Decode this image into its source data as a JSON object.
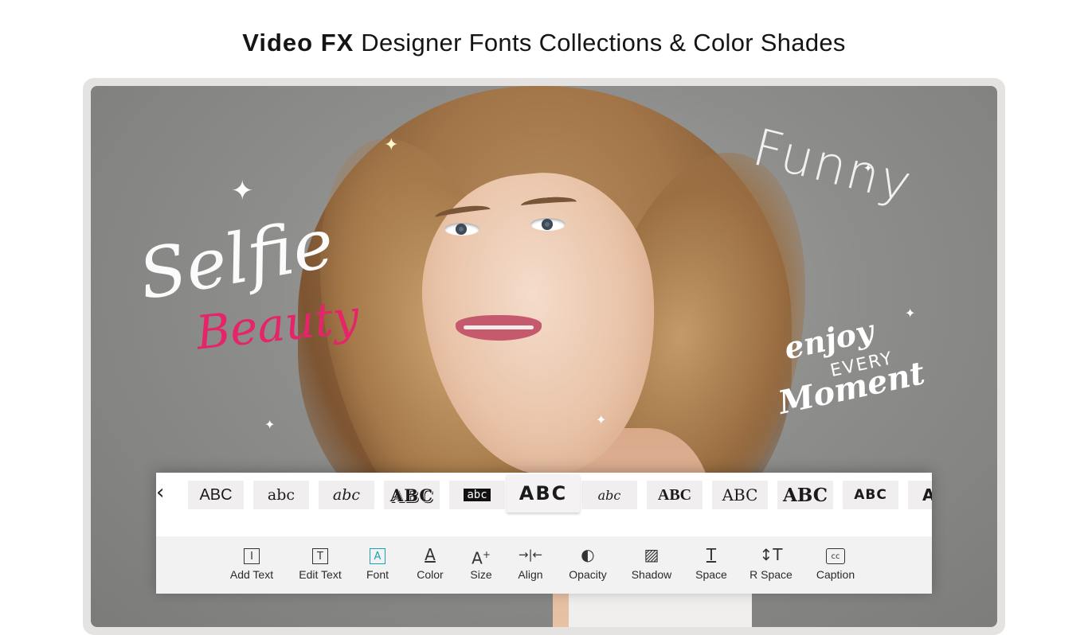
{
  "headline": {
    "bold": "Video FX",
    "rest": " Designer Fonts Collections & Color Shades"
  },
  "canvas_words": {
    "selfie": "Selfie",
    "beauty": "Beauty",
    "funny": "Funny",
    "enjoy": "enjoy",
    "every": "EVERY",
    "moment": "Moment"
  },
  "font_strip": {
    "prev_arrow": "‹",
    "samples": [
      "ABC",
      "abc",
      "abc",
      "ABC",
      "abc",
      "ABC",
      "abc",
      "ABC",
      "ABC",
      "ABC",
      "ABC",
      "A"
    ],
    "selected_index": 5
  },
  "toolbar": {
    "items": [
      {
        "label": "Add Text",
        "icon": "add-text-icon",
        "glyph": "I"
      },
      {
        "label": "Edit Text",
        "icon": "edit-text-icon",
        "glyph": "T"
      },
      {
        "label": "Font",
        "icon": "font-icon",
        "glyph": "A"
      },
      {
        "label": "Color",
        "icon": "color-icon",
        "glyph": "A"
      },
      {
        "label": "Size",
        "icon": "size-icon",
        "glyph": "A+"
      },
      {
        "label": "Align",
        "icon": "align-icon",
        "glyph": "→|←"
      },
      {
        "label": "Opacity",
        "icon": "opacity-icon",
        "glyph": "◐"
      },
      {
        "label": "Shadow",
        "icon": "shadow-icon",
        "glyph": "▨"
      },
      {
        "label": "Space",
        "icon": "space-icon",
        "glyph": "T"
      },
      {
        "label": "R Space",
        "icon": "row-space-icon",
        "glyph": "↕T"
      },
      {
        "label": "Caption",
        "icon": "caption-icon",
        "glyph": "cc"
      }
    ],
    "active_index": 2
  },
  "colors": {
    "accent": "#1aa3b8",
    "beauty_pink": "#e5246a"
  }
}
